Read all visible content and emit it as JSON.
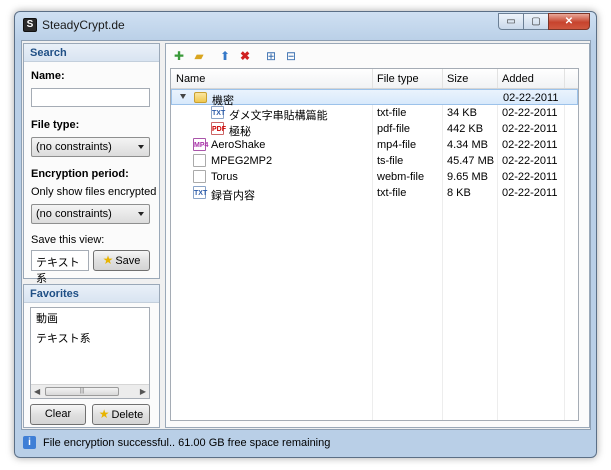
{
  "window": {
    "title": "SteadyCrypt.de",
    "icon": "S"
  },
  "window_controls": {
    "minimize": "▭",
    "maximize": "▢",
    "close": "✕"
  },
  "search": {
    "header": "Search",
    "name_label": "Name:",
    "name_value": "",
    "file_type_label": "File type:",
    "file_type_value": "(no constraints)",
    "period_label": "Encryption period:",
    "period_note": "Only show files encrypted",
    "period_value": "(no constraints)",
    "save_view_label": "Save this view:",
    "save_view_value": "テキスト系",
    "save_button": "Save"
  },
  "favorites": {
    "header": "Favorites",
    "items": [
      "動画",
      "テキスト系"
    ],
    "clear_button": "Clear",
    "delete_button": "Delete"
  },
  "toolbar": {
    "icons": [
      "add-files-icon",
      "add-folder-icon",
      "upload-icon",
      "delete-icon",
      "expand-all-icon",
      "collapse-all-icon"
    ]
  },
  "files": {
    "columns": [
      "Name",
      "File type",
      "Size",
      "Added"
    ],
    "rows": [
      {
        "name": "機密",
        "type": "",
        "size": "",
        "added": "02-22-2011",
        "icon": "folder-icon"
      },
      {
        "name": "ダメ文字串貼構篇能",
        "type": "txt-file",
        "size": "34 KB",
        "added": "02-22-2011",
        "icon": "txt-file-icon"
      },
      {
        "name": "極秘",
        "type": "pdf-file",
        "size": "442 KB",
        "added": "02-22-2011",
        "icon": "pdf-file-icon"
      },
      {
        "name": "AeroShake",
        "type": "mp4-file",
        "size": "4.34 MB",
        "added": "02-22-2011",
        "icon": "mp4-file-icon"
      },
      {
        "name": "MPEG2MP2",
        "type": "ts-file",
        "size": "45.47 MB",
        "added": "02-22-2011",
        "icon": "blank-file-icon"
      },
      {
        "name": "Torus",
        "type": "webm-file",
        "size": "9.65 MB",
        "added": "02-22-2011",
        "icon": "blank-file-icon"
      },
      {
        "name": "録音内容",
        "type": "txt-file",
        "size": "8 KB",
        "added": "02-22-2011",
        "icon": "txt-file-icon"
      }
    ]
  },
  "status": {
    "text": "File encryption successful.. 61.00 GB free space remaining"
  }
}
